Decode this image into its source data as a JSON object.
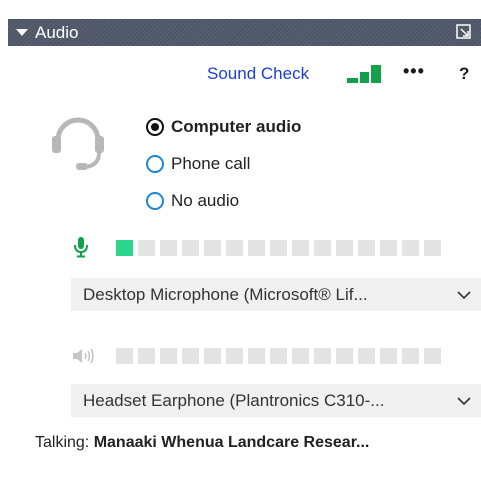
{
  "header": {
    "title": "Audio",
    "popout_icon": "popout-icon",
    "collapse_icon": "caret-down-icon",
    "background": "#4d5566"
  },
  "toolbar": {
    "sound_check_label": "Sound Check",
    "more_label": "•••",
    "help_label": "?",
    "signal_icon": "signal-bars-icon",
    "signal_color": "#12a04a",
    "link_color": "#1a3fd8"
  },
  "audio_options": {
    "icon": "headset-icon",
    "items": [
      {
        "label": "Computer audio",
        "selected": true
      },
      {
        "label": "Phone call",
        "selected": false
      },
      {
        "label": "No audio",
        "selected": false
      }
    ],
    "radio_color": "#1f86d6"
  },
  "microphone": {
    "icon": "microphone-icon",
    "icon_color": "#12a04a",
    "level_active_segments": 1,
    "level_total_segments": 15,
    "active_color": "#2cd68c",
    "device_selected": "Desktop Microphone (Microsoft® Lif..."
  },
  "speaker": {
    "icon": "speaker-icon",
    "level_active_segments": 0,
    "level_total_segments": 15,
    "device_selected": "Headset Earphone (Plantronics C310-..."
  },
  "talking": {
    "label": "Talking:",
    "name": "Manaaki Whenua Landcare Resear..."
  }
}
